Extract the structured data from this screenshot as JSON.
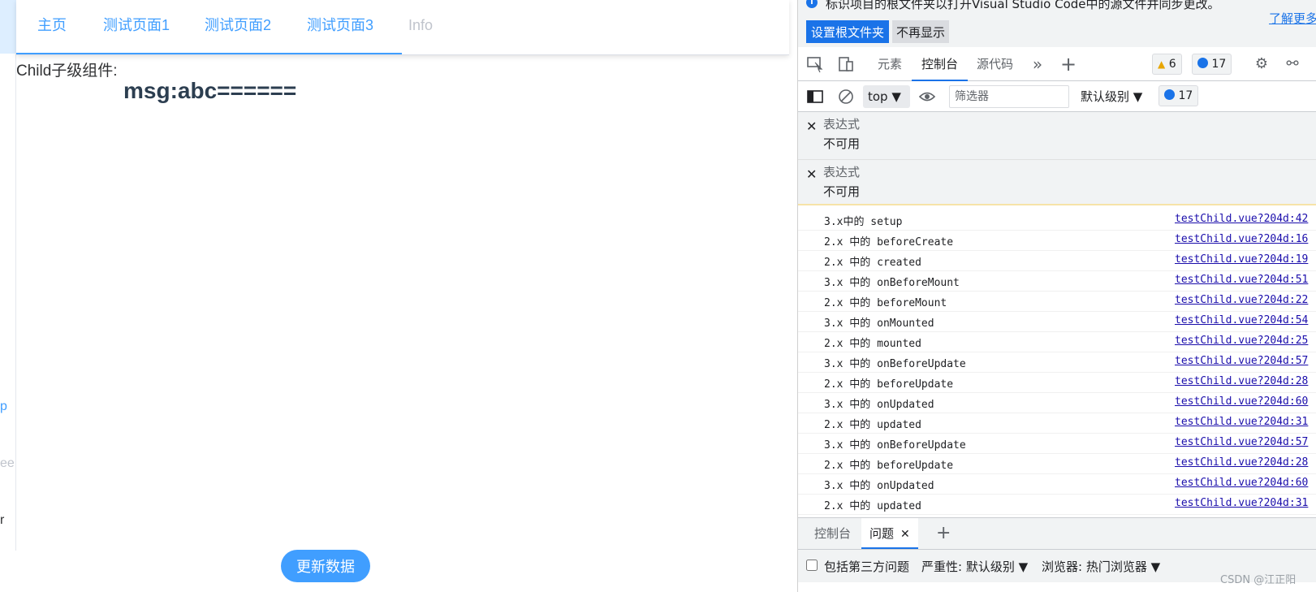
{
  "left_strip": {
    "fragments": [
      "p",
      "ee",
      "r"
    ]
  },
  "menu": {
    "items": [
      {
        "label": "主页"
      },
      {
        "label": "测试页面1"
      },
      {
        "label": "测试页面2"
      },
      {
        "label": "测试页面3"
      },
      {
        "label": "Info"
      }
    ]
  },
  "content": {
    "child_label": "Child子级组件:",
    "msg": "msg:abc======",
    "update_button": "更新数据"
  },
  "devtools": {
    "info_bar": {
      "text": "标识项目的根文件夹以打开Visual Studio Code中的源文件并同步更改。",
      "learn_more": "了解更多",
      "set_root_button": "设置根文件夹",
      "dont_show_button": "不再显示"
    },
    "tabs": [
      "元素",
      "控制台",
      "源代码"
    ],
    "active_tab": "控制台",
    "badges": {
      "warnings": "6",
      "messages": "17"
    },
    "console_toolbar": {
      "context": "top",
      "filter_placeholder": "筛选器",
      "levels": "默认级别",
      "message_count": "17"
    },
    "live_expressions": [
      {
        "label": "表达式",
        "value": "不可用"
      },
      {
        "label": "表达式",
        "value": "不可用"
      }
    ],
    "logs": [
      {
        "text": "3.x中的 setup",
        "source": "testChild.vue?204d:42"
      },
      {
        "text": "2.x 中的 beforeCreate",
        "source": "testChild.vue?204d:16"
      },
      {
        "text": "2.x 中的 created",
        "source": "testChild.vue?204d:19"
      },
      {
        "text": "3.x 中的 onBeforeMount",
        "source": "testChild.vue?204d:51"
      },
      {
        "text": "2.x 中的 beforeMount",
        "source": "testChild.vue?204d:22"
      },
      {
        "text": "3.x 中的 onMounted",
        "source": "testChild.vue?204d:54"
      },
      {
        "text": "2.x 中的 mounted",
        "source": "testChild.vue?204d:25"
      },
      {
        "text": "3.x 中的 onBeforeUpdate",
        "source": "testChild.vue?204d:57"
      },
      {
        "text": "2.x 中的 beforeUpdate",
        "source": "testChild.vue?204d:28"
      },
      {
        "text": "3.x 中的 onUpdated",
        "source": "testChild.vue?204d:60"
      },
      {
        "text": "2.x 中的 updated",
        "source": "testChild.vue?204d:31"
      },
      {
        "text": "3.x 中的 onBeforeUpdate",
        "source": "testChild.vue?204d:57"
      },
      {
        "text": "2.x 中的 beforeUpdate",
        "source": "testChild.vue?204d:28"
      },
      {
        "text": "3.x 中的 onUpdated",
        "source": "testChild.vue?204d:60"
      },
      {
        "text": "2.x 中的 updated",
        "source": "testChild.vue?204d:31"
      }
    ],
    "drawer": {
      "tabs": [
        "控制台",
        "问题"
      ],
      "active": "问题",
      "close": "✕"
    },
    "issues_toolbar": {
      "third_party": "包括第三方问题",
      "severity": "严重性: 默认级别 ▼",
      "browser": "浏览器:  热门浏览器 ▼"
    }
  },
  "watermark": "CSDN @江正阳"
}
